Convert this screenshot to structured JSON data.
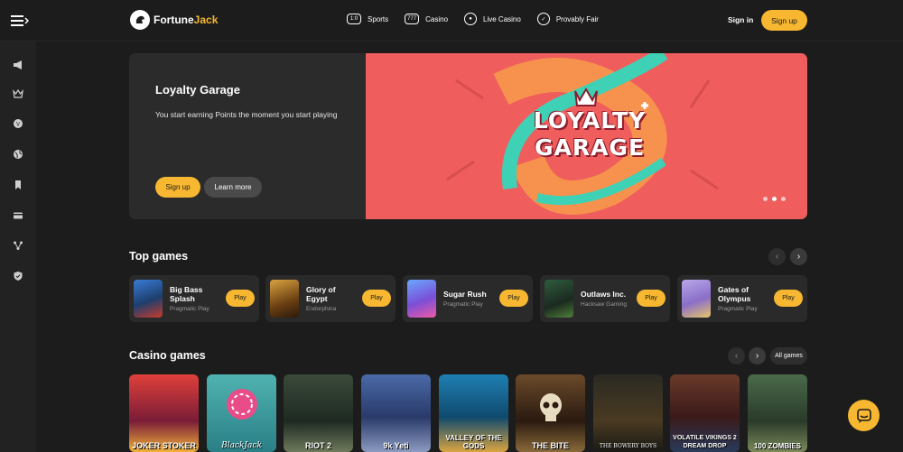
{
  "header": {
    "logo_text_1": "Fortune",
    "logo_text_2": "Jack",
    "nav": [
      {
        "label": "Sports",
        "icon": "sports-icon"
      },
      {
        "label": "Casino",
        "icon": "casino-icon"
      },
      {
        "label": "Live Casino",
        "icon": "live-casino-icon"
      },
      {
        "label": "Provably Fair",
        "icon": "provably-fair-icon"
      }
    ],
    "signin": "Sign in",
    "signup": "Sign up"
  },
  "sidebar": {
    "icons": [
      "megaphone-icon",
      "crown-icon",
      "coin-icon",
      "globe-icon",
      "bookmark-icon",
      "card-icon",
      "network-icon",
      "shield-icon"
    ]
  },
  "hero": {
    "title": "Loyalty Garage",
    "description": "You start earning Points the moment you start playing",
    "signup": "Sign up",
    "learn_more": "Learn more",
    "banner_line1": "LOYALTY",
    "banner_line2": "GARAGE",
    "slides": 3,
    "active_slide": 2
  },
  "top_games": {
    "title": "Top games",
    "items": [
      {
        "name": "Big Bass Splash",
        "provider": "Pragmatic Play",
        "play": "Play"
      },
      {
        "name": "Glory of Egypt",
        "provider": "Endorphina",
        "play": "Play"
      },
      {
        "name": "Sugar Rush",
        "provider": "Pragmatic Play",
        "play": "Play"
      },
      {
        "name": "Outlaws Inc.",
        "provider": "Hacksaw Gaming",
        "play": "Play"
      },
      {
        "name": "Gates of Olympus",
        "provider": "Pragmatic Play",
        "play": "Play"
      }
    ]
  },
  "casino_games": {
    "title": "Casino games",
    "all_games": "All games",
    "tiles": [
      {
        "label": "JOKER STOKER"
      },
      {
        "label": "BlackJack"
      },
      {
        "label": "RIOT 2"
      },
      {
        "label": "9k Yeti"
      },
      {
        "label": "VALLEY OF THE GODS"
      },
      {
        "label": "THE BITE"
      },
      {
        "label": "THE BOWERY BOYS"
      },
      {
        "label": "VOLATILE VIKINGS 2 DREAM DROP"
      },
      {
        "label": "100 ZOMBIES"
      }
    ]
  },
  "colors": {
    "accent": "#f7b731",
    "background": "#1c1c1c",
    "banner": "#ef5d5d"
  }
}
